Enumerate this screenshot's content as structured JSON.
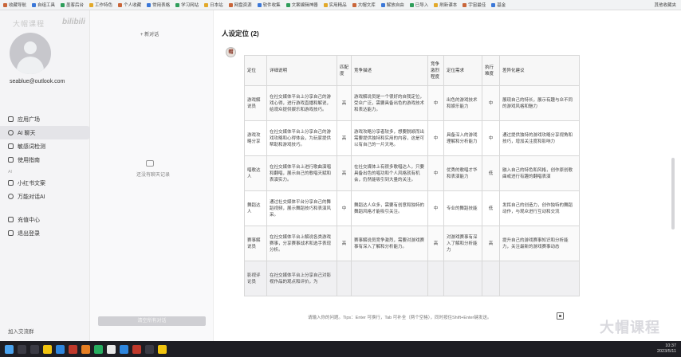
{
  "bookmarks": [
    "收藏导航",
    "自组工具",
    "墨客后台",
    "工作特色",
    "个人收藏",
    "常用表格",
    "学习网站",
    "日本站",
    "网盘资源",
    "软件收集",
    "文案编辑神器",
    "实用精品",
    "大帽文库",
    "解放自由",
    "已导入",
    "刷新课本",
    "宇宙最佳",
    "基金"
  ],
  "bookmarks_right": "其他收藏夹",
  "sidebar": {
    "watermark_left": "大帽课程",
    "watermark_right": "bilibili",
    "email": "seablue@outlook.com",
    "items": [
      {
        "label": "应用广场",
        "icon": "grid-icon"
      },
      {
        "label": "AI 聊天",
        "icon": "chat-icon"
      },
      {
        "label": "敏感词检测",
        "icon": "shield-icon"
      },
      {
        "label": "使用指南",
        "icon": "book-icon"
      }
    ],
    "section": "AI",
    "apps": [
      {
        "label": "小红书文案",
        "icon": "note-icon"
      },
      {
        "label": "万能对话AI",
        "icon": "robot-icon"
      }
    ],
    "account": [
      {
        "label": "充值中心",
        "icon": "wallet-icon"
      },
      {
        "label": "退出登录",
        "icon": "logout-icon"
      }
    ],
    "footer": "加入交流群"
  },
  "conversations": {
    "new_chat": "+ 新对话",
    "empty_text": "还没有聊天记录",
    "clear_button": "清空所有对话"
  },
  "chat": {
    "title": "人设定位 (2)",
    "bot_avatar": "帽",
    "table": {
      "headers": [
        "定位",
        "详细说明",
        "匹配度",
        "竞争描述",
        "竞争激烈程度",
        "定位需求",
        "执行难度",
        "差异化建议"
      ],
      "rows": [
        [
          "游戏解说员",
          "在社交媒体平台上分享自己的游戏心得，进行游戏直播和解说，给观众提供娱乐和游戏技巧。",
          "高",
          "游戏解说员是一个很好的自我定位，受众广泛，需要具备出色的游戏技术和表达能力。",
          "中",
          "出色的游戏技术和娱乐能力",
          "中",
          "展现自己的特长，展示有趣与众不同的游戏风格和魅力"
        ],
        [
          "游戏攻略分享",
          "在社交媒体平台上分享自己的游戏攻略和心得体会，为玩家提供帮助和游戏技巧。",
          "高",
          "游戏攻略分享者较多，想要脱颖而出需要提供独特和实用的内容，这是可以有自己的一片天地。",
          "中",
          "具备深入的游戏理解和分析能力",
          "中",
          "通过提供独特的游戏攻略分享视角和技巧，增加关注度和影响力"
        ],
        [
          "唱歌达人",
          "在社交媒体平台上进行歌曲演唱和翻唱，展示自己的歌唱天赋和表演实力。",
          "高",
          "在社交媒体上有很多歌唱达人，只要具备出色的唱功和个人风格就有机会，仍然能吸引到大量的关注。",
          "中",
          "优秀的歌唱才华和表演能力",
          "低",
          "融入自己的特色和风格，创作原创歌曲或进行有趣的翻唱表演"
        ],
        [
          "舞蹈达人",
          "通过社交媒体平台分享自己的舞蹈视频，展示舞蹈技巧和表演风采。",
          "中",
          "舞蹈达人众多，需要有创意和独特的舞蹈风格才能吸引关注。",
          "中",
          "专业的舞蹈技能",
          "低",
          "发挥自己的创造力，创作独特的舞蹈动作，与观众进行互动和交流"
        ],
        [
          "赛事解说员",
          "在社交媒体平台上解说各类游戏赛事，分享赛事战术和选手表现分析。",
          "高",
          "赛事解说员竞争激烈，需要对游戏赛事有深入了解和分析能力。",
          "高",
          "对游戏赛事有深入了解和分析能力",
          "高",
          "提升自己的游戏赛事知识和分析能力，关注最新的游戏赛事动态"
        ],
        [
          "影视评论员",
          "在社交媒体平台上分享自己对影视作品的观点和评价，为",
          "",
          "",
          "",
          "",
          "",
          ""
        ]
      ]
    },
    "input_hint": "请输入你的问题。Tips：Enter 可换行，Tab 可补全（两个空格），同时按住Shift+Enter键发送。",
    "watermark": "大帽课程"
  },
  "taskbar": {
    "time": "10:37",
    "date": "2023/5/11"
  }
}
